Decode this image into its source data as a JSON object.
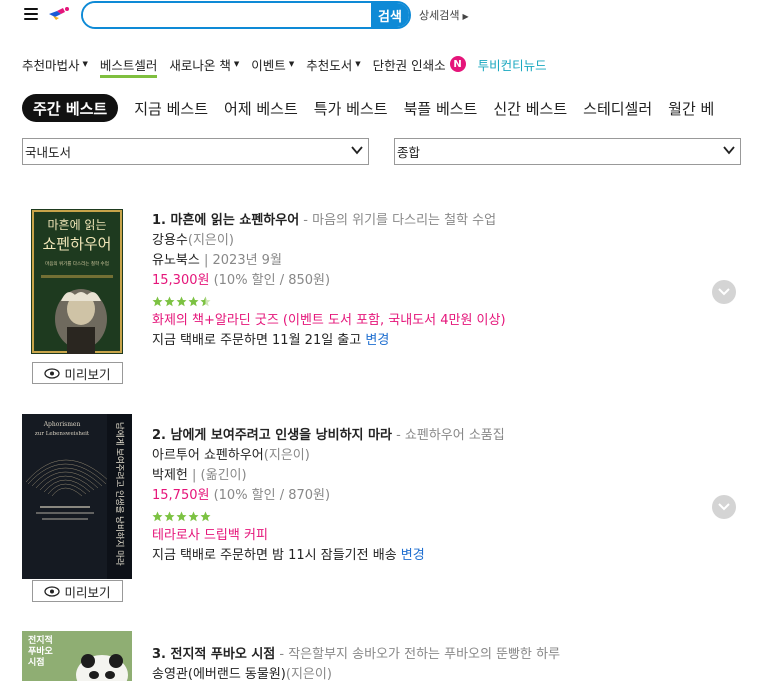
{
  "search": {
    "value": "",
    "placeholder": "",
    "button_label": "검색",
    "advanced_label": "상세검색"
  },
  "nav": {
    "items": [
      {
        "label": "추천마법사",
        "has_menu": true
      },
      {
        "label": "베스트셀러",
        "has_menu": false,
        "active": true
      },
      {
        "label": "새로나온 책",
        "has_menu": true
      },
      {
        "label": "이벤트",
        "has_menu": true
      },
      {
        "label": "추천도서",
        "has_menu": true
      },
      {
        "label": "단한권 인쇄소",
        "has_menu": false,
        "badge": "N"
      },
      {
        "label": "투비컨티뉴드",
        "has_menu": false
      }
    ]
  },
  "tabs": [
    "주간 베스트",
    "지금 베스트",
    "어제 베스트",
    "특가 베스트",
    "북플 베스트",
    "신간 베스트",
    "스테디셀러",
    "월간 베"
  ],
  "filters": {
    "category": "국내도서",
    "sort": "종합"
  },
  "books": [
    {
      "rank_title": "1. 마흔에 읽는 쇼펜하우어",
      "subtitle": " - 마음의 위기를 다스리는 철학 수업",
      "author": "강용수",
      "author_role": "(지은이)",
      "publisher": "유노북스",
      "pubdate": "2023년 9월",
      "price": "15,300원",
      "discount": " (10% 할인 / 850원)",
      "rating": 4.5,
      "event": "화제의 책+알라딘 굿즈 (이벤트 도서 포함, 국내도서 4만원 이상)",
      "delivery": "지금 택배로 주문하면 11월 21일 출고",
      "change_label": "변경",
      "preview_label": "미리보기",
      "cover": {
        "title_line1": "마흔에 읽는",
        "title_line2": "쇼펜하우어",
        "tagline": "마음의 위기를 다스리는 철학 수업",
        "colors": {
          "bg": "#1e3a1f",
          "border": "#c8a44a",
          "text": "#f1e6b8"
        }
      }
    },
    {
      "rank_title": "2. 남에게 보여주려고 인생을 낭비하지 마라",
      "subtitle": " - 쇼펜하우어 소품집",
      "author": "아르투어 쇼펜하우어",
      "author_role": "(지은이)",
      "publisher": "박제헌",
      "pubdate": "(옮긴이)",
      "price": "15,750원",
      "discount": " (10% 할인 / 870원)",
      "rating": 5,
      "event": "테라로사 드립백 커피",
      "delivery": "지금 택배로 주문하면 밤 11시 잠들기전 배송",
      "change_label": "변경",
      "preview_label": "미리보기",
      "cover": {
        "title_line1": "Aphorismen",
        "title_line2": "zur Lebensweisheit",
        "spine_text": "남에게 보여주려고 인생을 낭비하지 마라",
        "colors": {
          "bg": "#151a22",
          "text": "#d7d0c0"
        }
      }
    },
    {
      "rank_title": "3. 전지적 푸바오 시점",
      "subtitle": " - 작은할부지 송바오가 전하는 푸바오의 뚠빵한 하루",
      "author": "송영관(에버랜드 동물원)",
      "author_role": "(지은이)",
      "cover": {
        "title_line1": "전지적",
        "title_line2": "푸바오",
        "title_line3": "시점",
        "colors": {
          "bg": "#8fae73",
          "text": "#ffffff"
        }
      }
    }
  ],
  "colors": {
    "accent_blue": "#0e8ad6",
    "price_pink": "#e5157a",
    "link_blue": "#1f6fd0",
    "active_underline": "#7fbf3f",
    "star_green": "#7cc242"
  }
}
